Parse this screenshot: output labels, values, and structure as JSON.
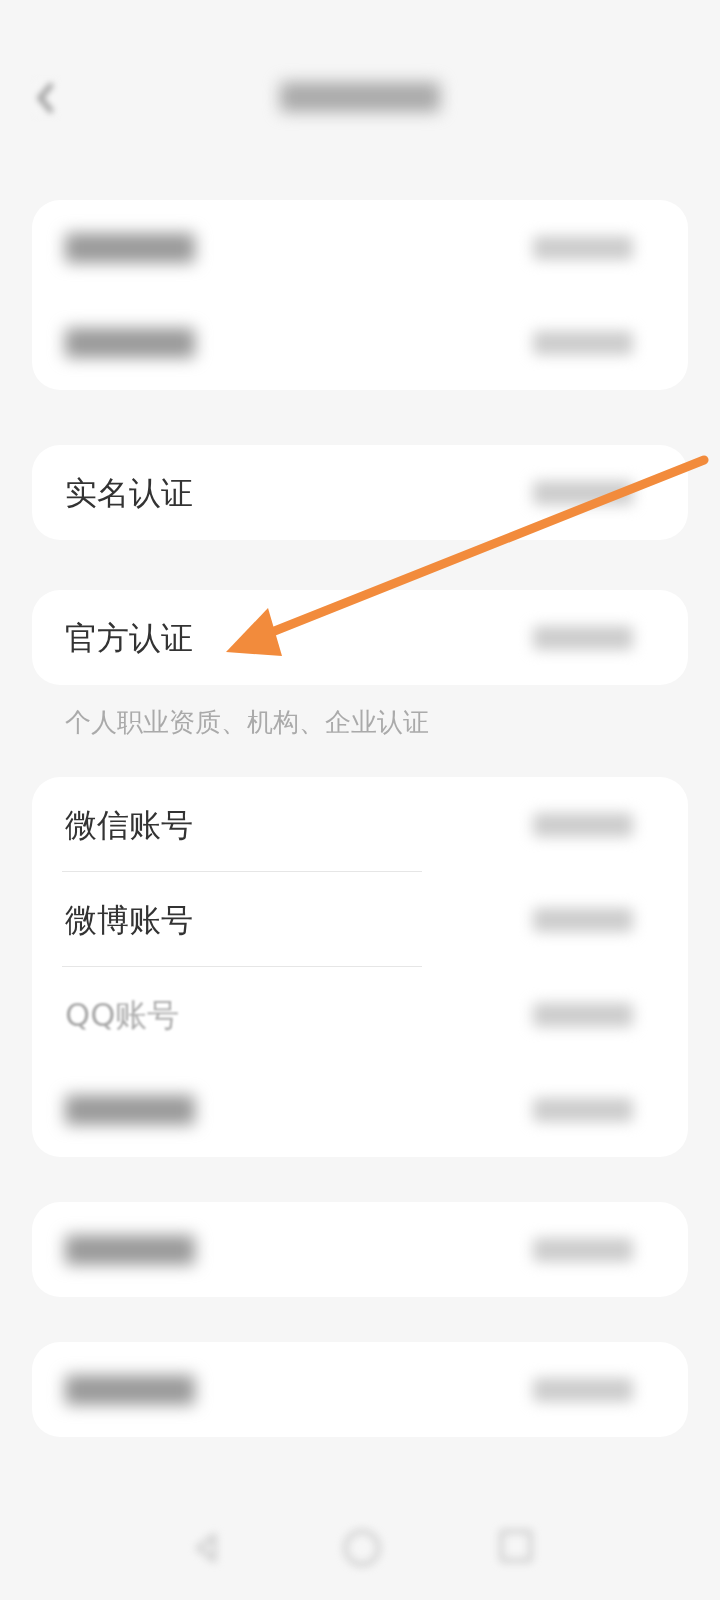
{
  "sections": [
    {
      "rows": [
        {
          "kind": "blurred"
        },
        {
          "kind": "blurred"
        }
      ]
    },
    {
      "rows": [
        {
          "kind": "text",
          "label": "实名认证",
          "dimmed": false
        }
      ]
    },
    {
      "rows": [
        {
          "kind": "text",
          "label": "官方认证",
          "dimmed": false
        }
      ],
      "caption": "个人职业资质、机构、企业认证"
    },
    {
      "rows": [
        {
          "kind": "text",
          "label": "微信账号",
          "dimmed": false
        },
        {
          "kind": "text",
          "label": "微博账号",
          "dimmed": false
        },
        {
          "kind": "text",
          "label": "QQ账号",
          "dimmed": true
        },
        {
          "kind": "blurred"
        }
      ]
    },
    {
      "rows": [
        {
          "kind": "blurred"
        }
      ]
    },
    {
      "rows": [
        {
          "kind": "blurred"
        }
      ]
    }
  ]
}
